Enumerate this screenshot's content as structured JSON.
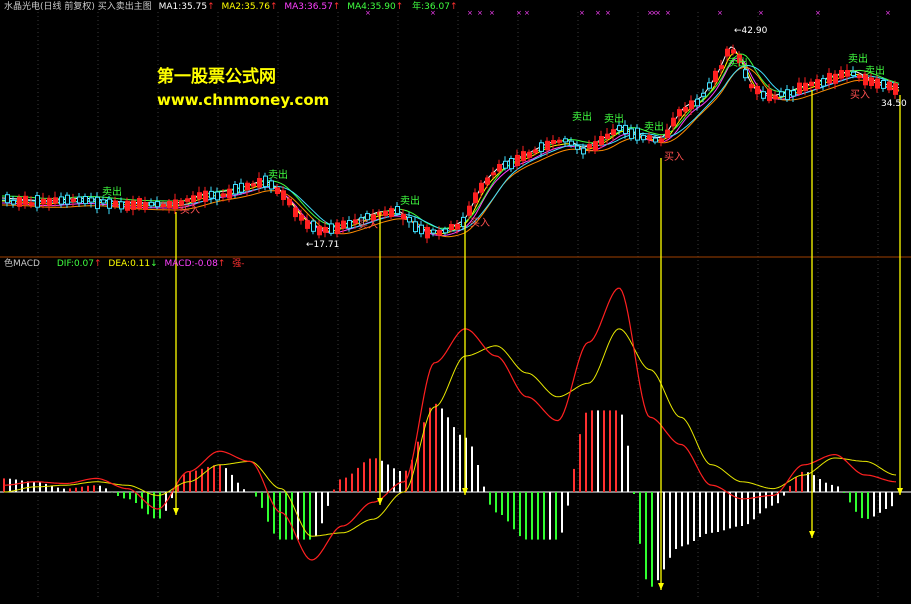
{
  "header": {
    "title": "水晶光电(日线 前复权) 买入卖出主图",
    "ma1": "MA1:35.75",
    "ma2": "MA2:35.76",
    "ma3": "MA3:36.57",
    "ma4": "MA4:35.90",
    "extra": "年:36.07"
  },
  "watermark": {
    "line1": "第一股票公式网",
    "line2": "www.chnmoney.com"
  },
  "price_panel": {
    "high_label": "42.90",
    "low_label": "17.71",
    "right_label": "34.50",
    "buy_label": "买入",
    "sell_label": "卖出"
  },
  "macd_panel": {
    "name": "色MACD",
    "dif": "DIF:0.07",
    "dea": "DEA:0.11",
    "macd": "MACD:-0.08",
    "extra": "强-"
  },
  "colors": {
    "background": "#000000",
    "up_candle": "#ff2020",
    "down_candle": "#40e0ff",
    "dif_line": "#ff2020",
    "dea_line": "#e8e800",
    "hist_up": "#ff3030",
    "hist_down": "#30ff30",
    "hist_weak": "#ffffff",
    "arrow": "#ffff00",
    "divider": "#a04000"
  },
  "chart_data": {
    "type": "line",
    "series": [
      {
        "name": "DIF",
        "values": [
          0.2,
          0.3,
          0.25,
          0.4,
          0.1,
          -0.5,
          0.6,
          1.2,
          0.9,
          -0.6,
          -2.0,
          -1.0,
          -0.3,
          0.3,
          3.8,
          4.8,
          4.0,
          2.8,
          2.1,
          4.4,
          6.0,
          2.2,
          1.4,
          0.2,
          -0.2,
          -0.1,
          0.8,
          1.1,
          0.5,
          0.3
        ]
      },
      {
        "name": "DEA",
        "values": [
          0.0,
          0.15,
          0.2,
          0.3,
          0.2,
          -0.1,
          0.3,
          0.8,
          0.9,
          0.1,
          -1.3,
          -1.2,
          -0.8,
          0.0,
          2.5,
          4.0,
          4.3,
          3.5,
          2.8,
          3.2,
          4.8,
          3.6,
          2.2,
          0.8,
          0.3,
          0.1,
          0.5,
          1.0,
          0.9,
          0.5
        ]
      }
    ],
    "signal_arrows": 6
  }
}
